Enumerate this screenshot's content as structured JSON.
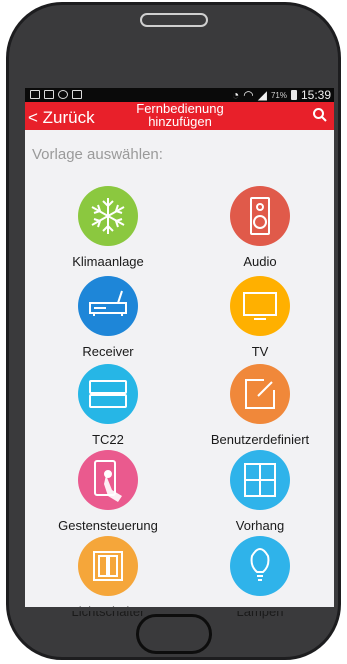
{
  "status": {
    "battery_percent": "71%",
    "time": "15:39"
  },
  "appbar": {
    "back_label": "< Zurück",
    "title_line1": "Fernbedienung",
    "title_line2": "hinzufügen"
  },
  "subtitle": "Vorlage auswählen:",
  "templates": [
    {
      "label": "Klimaanlage",
      "icon": "snowflake-icon",
      "color": "#8bc83f"
    },
    {
      "label": "Audio",
      "icon": "speaker-icon",
      "color": "#e05a4a"
    },
    {
      "label": "Receiver",
      "icon": "receiver-icon",
      "color": "#1e86d8"
    },
    {
      "label": "TV",
      "icon": "tv-icon",
      "color": "#ffb000"
    },
    {
      "label": "TC22",
      "icon": "tc22-icon",
      "color": "#26b6e6"
    },
    {
      "label": "Benutzerdefiniert",
      "icon": "edit-icon",
      "color": "#f0883a"
    },
    {
      "label": "Gestensteuerung",
      "icon": "gesture-icon",
      "color": "#ea5a8e"
    },
    {
      "label": "Vorhang",
      "icon": "window-icon",
      "color": "#2fb3ea"
    },
    {
      "label": "Lichtschalter",
      "icon": "light-switch-icon",
      "color": "#f5a63a"
    },
    {
      "label": "Lampen",
      "icon": "lamp-icon",
      "color": "#2fb3ea"
    }
  ]
}
